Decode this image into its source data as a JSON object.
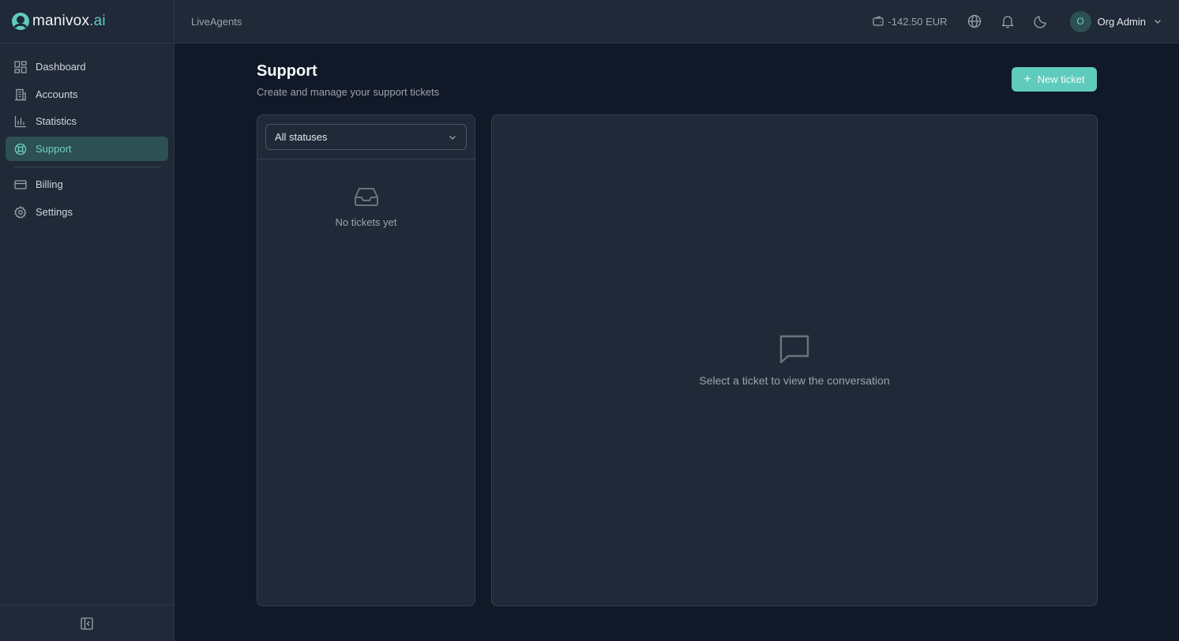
{
  "brand": {
    "name": "manivox",
    "suffix": ".ai"
  },
  "sidebar": {
    "items": [
      {
        "label": "Dashboard",
        "icon": "dashboard-icon",
        "active": false
      },
      {
        "label": "Accounts",
        "icon": "building-icon",
        "active": false
      },
      {
        "label": "Statistics",
        "icon": "bar-chart-icon",
        "active": false
      },
      {
        "label": "Support",
        "icon": "lifebuoy-icon",
        "active": true
      },
      {
        "label": "Billing",
        "icon": "credit-card-icon",
        "active": false
      },
      {
        "label": "Settings",
        "icon": "gear-icon",
        "active": false
      }
    ]
  },
  "header": {
    "org_name": "LiveAgents",
    "balance": "-142.50 EUR",
    "user": {
      "initial": "O",
      "name": "Org Admin"
    }
  },
  "main": {
    "title": "Support",
    "subtitle": "Create and manage your support tickets",
    "new_ticket_label": "New ticket",
    "status_filter": "All statuses",
    "empty_list_text": "No tickets yet",
    "empty_conversation_text": "Select a ticket to view the conversation"
  },
  "colors": {
    "accent": "#5fcbbd",
    "background": "#111827",
    "surface": "#1f2937"
  }
}
